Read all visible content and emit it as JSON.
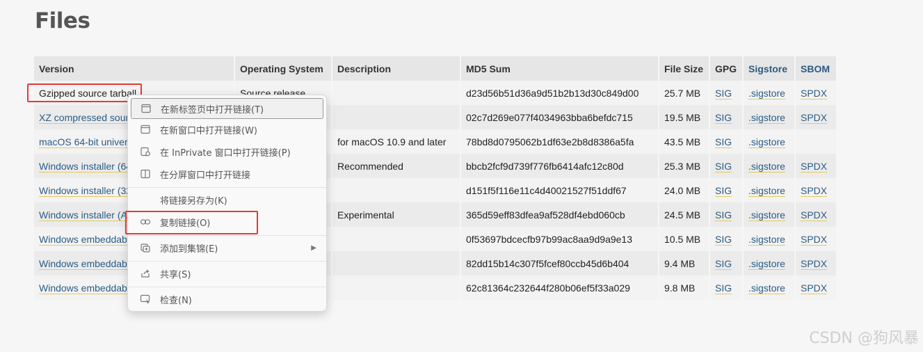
{
  "page": {
    "title": "Files"
  },
  "table": {
    "headers": {
      "version": "Version",
      "os": "Operating System",
      "description": "Description",
      "md5": "MD5 Sum",
      "size": "File Size",
      "gpg": "GPG",
      "sigstore": "Sigstore",
      "sbom": "SBOM"
    },
    "rows": [
      {
        "version": "Gzipped source tarball",
        "os": "Source release",
        "description": "",
        "md5": "d23d56b51d36a9d51b2b13d30c849d00",
        "size": "25.7 MB",
        "gpg": "SIG",
        "sigstore": ".sigstore",
        "sbom": "SPDX"
      },
      {
        "version": "XZ compressed sourc",
        "os": "",
        "description": "",
        "md5": "02c7d269e077f4034963bba6befdc715",
        "size": "19.5 MB",
        "gpg": "SIG",
        "sigstore": ".sigstore",
        "sbom": "SPDX"
      },
      {
        "version": "macOS 64-bit univer",
        "os": "",
        "description": "for macOS 10.9 and later",
        "md5": "78bd8d0795062b1df63e2b8d8386a5fa",
        "size": "43.5 MB",
        "gpg": "SIG",
        "sigstore": ".sigstore",
        "sbom": ""
      },
      {
        "version": "Windows installer (64",
        "os": "",
        "description": "Recommended",
        "md5": "bbcb2fcf9d739f776fb6414afc12c80d",
        "size": "25.3 MB",
        "gpg": "SIG",
        "sigstore": ".sigstore",
        "sbom": "SPDX"
      },
      {
        "version": "Windows installer (32",
        "os": "",
        "description": "",
        "md5": "d151f5f116e11c4d40021527f51ddf67",
        "size": "24.0 MB",
        "gpg": "SIG",
        "sigstore": ".sigstore",
        "sbom": "SPDX"
      },
      {
        "version": "Windows installer (A",
        "os": "",
        "description": "Experimental",
        "md5": "365d59eff83dfea9af528df4ebd060cb",
        "size": "24.5 MB",
        "gpg": "SIG",
        "sigstore": ".sigstore",
        "sbom": "SPDX"
      },
      {
        "version": "Windows embeddab",
        "os": "",
        "description": "",
        "md5": "0f53697bdcecfb97b99ac8aa9d9a9e13",
        "size": "10.5 MB",
        "gpg": "SIG",
        "sigstore": ".sigstore",
        "sbom": "SPDX"
      },
      {
        "version": "Windows embeddab",
        "os": "",
        "description": "",
        "md5": "82dd15b14c307f5fcef80ccb45d6b404",
        "size": "9.4 MB",
        "gpg": "SIG",
        "sigstore": ".sigstore",
        "sbom": "SPDX"
      },
      {
        "version": "Windows embeddab",
        "os": "",
        "description": "",
        "md5": "62c81364c232644f280b06ef5f33a029",
        "size": "9.8 MB",
        "gpg": "SIG",
        "sigstore": ".sigstore",
        "sbom": "SPDX"
      }
    ]
  },
  "context_menu": {
    "items": [
      {
        "label": "在新标签页中打开链接(T)",
        "icon": "new-tab-icon"
      },
      {
        "label": "在新窗口中打开链接(W)",
        "icon": "new-window-icon"
      },
      {
        "label": "在 InPrivate 窗口中打开链接(P)",
        "icon": "inprivate-icon"
      },
      {
        "label": "在分屏窗口中打开链接",
        "icon": "split-screen-icon"
      },
      {
        "label": "将链接另存为(K)",
        "icon": ""
      },
      {
        "label": "复制链接(O)",
        "icon": "link-icon"
      },
      {
        "label": "添加到集锦(E)",
        "icon": "collections-icon"
      },
      {
        "label": "共享(S)",
        "icon": "share-icon"
      },
      {
        "label": "检查(N)",
        "icon": "inspect-icon"
      }
    ]
  },
  "colors": {
    "link": "#2b5b84",
    "highlight": "#e53935"
  },
  "watermark": "CSDN @狗风暴"
}
